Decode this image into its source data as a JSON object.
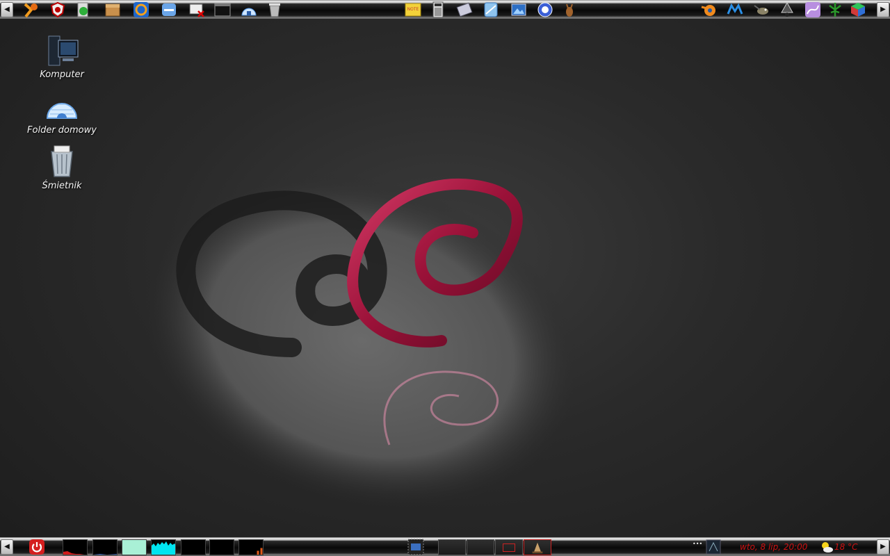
{
  "desktop": {
    "icons": [
      {
        "label": "Komputer",
        "icon": "computer-icon"
      },
      {
        "label": "Folder domowy",
        "icon": "igloo-home-icon"
      },
      {
        "label": "Śmietnik",
        "icon": "trash-icon"
      }
    ]
  },
  "top_panel": {
    "left_launchers": [
      "xchat-icon",
      "antivirus-icon",
      "recycle-updater-icon",
      "debian-package-icon",
      "swirl-app-icon",
      "drive-icon",
      "xkill-icon",
      "terminal-icon",
      "home-igloo-icon",
      "trash-icon"
    ],
    "center_launchers": [
      "note-icon",
      "calculator-icon",
      "screenshot-icon",
      "file-manager-icon",
      "image-viewer-icon",
      "help-icon",
      "emule-icon"
    ],
    "right_launchers": [
      "blender-icon",
      "maya-icon",
      "gimp-icon",
      "inkscape-icon",
      "purple-app-icon",
      "cannabis-icon",
      "cube-icon"
    ],
    "note_label": "NOTE"
  },
  "bottom_panel": {
    "clock": "wto, 8 lip, 20:00",
    "temperature": "18 °C",
    "tray_dots": "•••"
  },
  "colors": {
    "swirl": "#a0143c",
    "clock_text": "#cc1111",
    "monitor_red": "#d11a1a",
    "monitor_cyan": "#00e4ef",
    "monitor_mint": "#a9f0d6"
  }
}
